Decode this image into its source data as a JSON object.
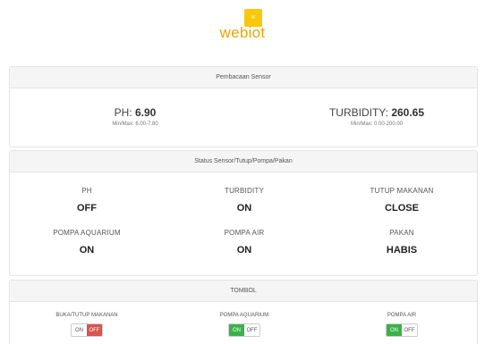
{
  "logo": {
    "icon": "logo-square-icon",
    "mark": "W",
    "name": "webiot",
    "color": "#f7c90a"
  },
  "sensor_reading": {
    "title": "Pembacaan Sensor",
    "ph": {
      "label": "PH:",
      "value": "6.90",
      "range": "Min/Max: 6.00-7.80"
    },
    "turbidity": {
      "label": "TURBIDITY:",
      "value": "260.65",
      "range": "Min/Max: 0.00-200.00"
    }
  },
  "status": {
    "title": "Status Sensor/Tutup/Pompa/Pakan",
    "items": [
      {
        "label": "PH",
        "value": "OFF"
      },
      {
        "label": "TURBIDITY",
        "value": "ON"
      },
      {
        "label": "TUTUP MAKANAN",
        "value": "CLOSE"
      },
      {
        "label": "POMPA AQUARIUM",
        "value": "ON"
      },
      {
        "label": "POMPA AIR",
        "value": "ON"
      },
      {
        "label": "PAKAN",
        "value": "HABIS"
      }
    ]
  },
  "tombol": {
    "title": "TOMBOL",
    "controls": [
      {
        "label": "BUKA/TUTUP MAKANAN",
        "on": "ON",
        "off": "OFF",
        "state": "OFF"
      },
      {
        "label": "POMPA AQUARIUM",
        "on": "ON",
        "off": "OFF",
        "state": "ON"
      },
      {
        "label": "POMPA AIR",
        "on": "ON",
        "off": "OFF",
        "state": "ON"
      }
    ]
  },
  "colors": {
    "brand": "#e8a600",
    "on": "#3cb14a",
    "off": "#d9534f"
  }
}
